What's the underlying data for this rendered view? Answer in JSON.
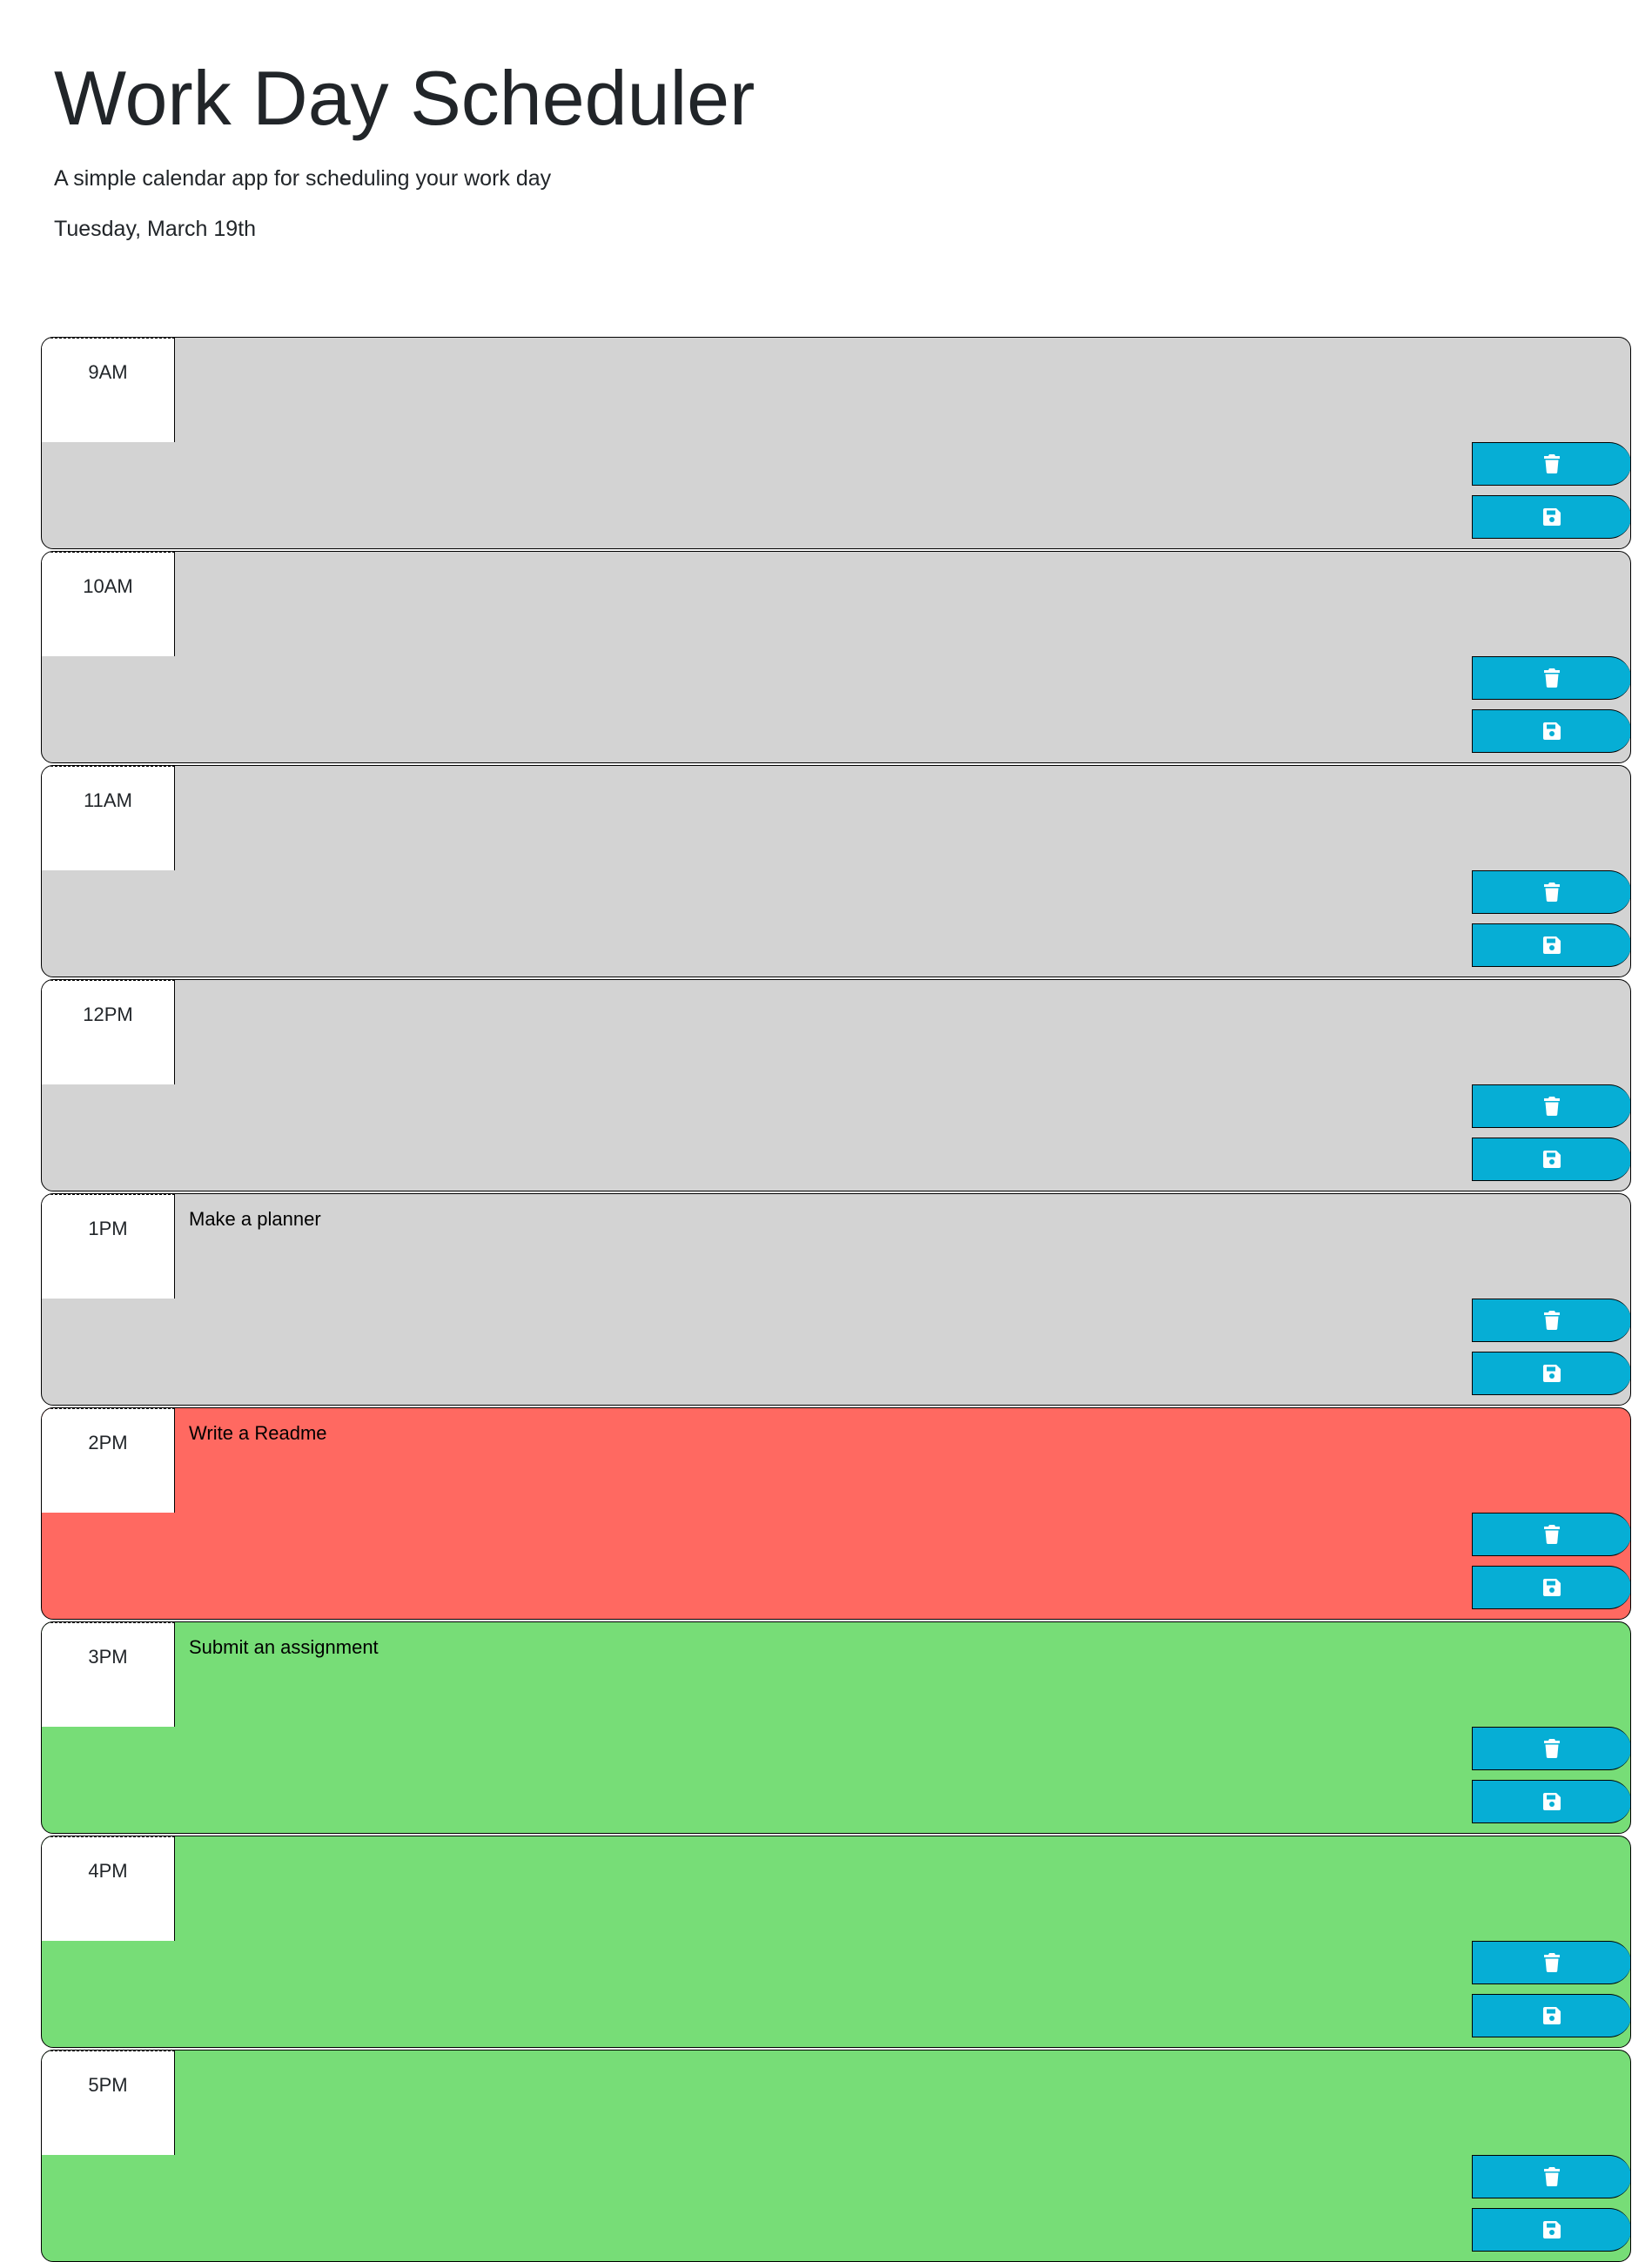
{
  "header": {
    "title": "Work Day Scheduler",
    "subtitle": "A simple calendar app for scheduling your work day",
    "current_day": "Tuesday, March 19th"
  },
  "colors": {
    "past": "#d3d3d3",
    "present": "#ff6961",
    "future": "#77dd77",
    "button": "#06aed5"
  },
  "time_blocks": [
    {
      "hour": "9AM",
      "text": "",
      "state": "past"
    },
    {
      "hour": "10AM",
      "text": "",
      "state": "past"
    },
    {
      "hour": "11AM",
      "text": "",
      "state": "past"
    },
    {
      "hour": "12PM",
      "text": "",
      "state": "past"
    },
    {
      "hour": "1PM",
      "text": "Make a planner",
      "state": "past"
    },
    {
      "hour": "2PM",
      "text": "Write a Readme",
      "state": "present"
    },
    {
      "hour": "3PM",
      "text": "Submit an assignment",
      "state": "future"
    },
    {
      "hour": "4PM",
      "text": "",
      "state": "future"
    },
    {
      "hour": "5PM",
      "text": "",
      "state": "future"
    }
  ],
  "icons": {
    "delete": "trash-icon",
    "save": "floppy-disk-icon"
  }
}
